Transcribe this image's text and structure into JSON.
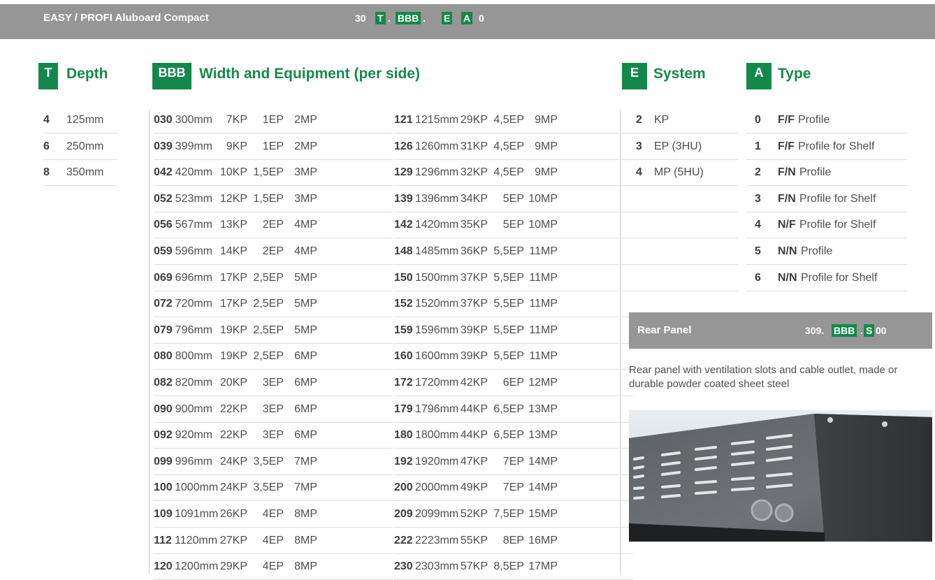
{
  "header": {
    "title": "EASY / PROFI Aluboard Compact",
    "code": {
      "prefix": "30",
      "t": "T",
      "sep1": ".",
      "bbb": "BBB",
      "sep2": ".",
      "e": "E",
      "a": "A",
      "suffix": "0"
    }
  },
  "sections": {
    "depth": {
      "badge": "T",
      "title": "Depth"
    },
    "width": {
      "badge": "BBB",
      "title": "Width and Equipment (per side)"
    },
    "system": {
      "badge": "E",
      "title": "System"
    },
    "type": {
      "badge": "A",
      "title": "Type"
    }
  },
  "depth_rows": [
    {
      "code": "4",
      "value": "125mm"
    },
    {
      "code": "6",
      "value": "250mm"
    },
    {
      "code": "8",
      "value": "350mm"
    }
  ],
  "width_left": [
    {
      "code": "030",
      "mm": "300mm",
      "kp": "7KP",
      "ep": "1EP",
      "mp": "2MP"
    },
    {
      "code": "039",
      "mm": "399mm",
      "kp": "9KP",
      "ep": "1EP",
      "mp": "2MP"
    },
    {
      "code": "042",
      "mm": "420mm",
      "kp": "10KP",
      "ep": "1,5EP",
      "mp": "3MP"
    },
    {
      "code": "052",
      "mm": "523mm",
      "kp": "12KP",
      "ep": "1,5EP",
      "mp": "3MP"
    },
    {
      "code": "056",
      "mm": "567mm",
      "kp": "13KP",
      "ep": "2EP",
      "mp": "4MP"
    },
    {
      "code": "059",
      "mm": "596mm",
      "kp": "14KP",
      "ep": "2EP",
      "mp": "4MP"
    },
    {
      "code": "069",
      "mm": "696mm",
      "kp": "17KP",
      "ep": "2,5EP",
      "mp": "5MP"
    },
    {
      "code": "072",
      "mm": "720mm",
      "kp": "17KP",
      "ep": "2,5EP",
      "mp": "5MP"
    },
    {
      "code": "079",
      "mm": "796mm",
      "kp": "19KP",
      "ep": "2,5EP",
      "mp": "5MP"
    },
    {
      "code": "080",
      "mm": "800mm",
      "kp": "19KP",
      "ep": "2,5EP",
      "mp": "6MP"
    },
    {
      "code": "082",
      "mm": "820mm",
      "kp": "20KP",
      "ep": "3EP",
      "mp": "6MP"
    },
    {
      "code": "090",
      "mm": "900mm",
      "kp": "22KP",
      "ep": "3EP",
      "mp": "6MP"
    },
    {
      "code": "092",
      "mm": "920mm",
      "kp": "22KP",
      "ep": "3EP",
      "mp": "6MP"
    },
    {
      "code": "099",
      "mm": "996mm",
      "kp": "24KP",
      "ep": "3,5EP",
      "mp": "7MP"
    },
    {
      "code": "100",
      "mm": "1000mm",
      "kp": "24KP",
      "ep": "3,5EP",
      "mp": "7MP"
    },
    {
      "code": "109",
      "mm": "1091mm",
      "kp": "26KP",
      "ep": "4EP",
      "mp": "8MP"
    },
    {
      "code": "112",
      "mm": "1120mm",
      "kp": "27KP",
      "ep": "4EP",
      "mp": "8MP"
    },
    {
      "code": "120",
      "mm": "1200mm",
      "kp": "29KP",
      "ep": "4EP",
      "mp": "8MP"
    }
  ],
  "width_right": [
    {
      "code": "121",
      "mm": "1215mm",
      "kp": "29KP",
      "ep": "4,5EP",
      "mp": "9MP"
    },
    {
      "code": "126",
      "mm": "1260mm",
      "kp": "31KP",
      "ep": "4,5EP",
      "mp": "9MP"
    },
    {
      "code": "129",
      "mm": "1296mm",
      "kp": "32KP",
      "ep": "4,5EP",
      "mp": "9MP"
    },
    {
      "code": "139",
      "mm": "1396mm",
      "kp": "34KP",
      "ep": "5EP",
      "mp": "10MP"
    },
    {
      "code": "142",
      "mm": "1420mm",
      "kp": "35KP",
      "ep": "5EP",
      "mp": "10MP"
    },
    {
      "code": "148",
      "mm": "1485mm",
      "kp": "36KP",
      "ep": "5,5EP",
      "mp": "11MP"
    },
    {
      "code": "150",
      "mm": "1500mm",
      "kp": "37KP",
      "ep": "5,5EP",
      "mp": "11MP"
    },
    {
      "code": "152",
      "mm": "1520mm",
      "kp": "37KP",
      "ep": "5,5EP",
      "mp": "11MP"
    },
    {
      "code": "159",
      "mm": "1596mm",
      "kp": "39KP",
      "ep": "5,5EP",
      "mp": "11MP"
    },
    {
      "code": "160",
      "mm": "1600mm",
      "kp": "39KP",
      "ep": "5,5EP",
      "mp": "11MP"
    },
    {
      "code": "172",
      "mm": "1720mm",
      "kp": "42KP",
      "ep": "6EP",
      "mp": "12MP"
    },
    {
      "code": "179",
      "mm": "1796mm",
      "kp": "44KP",
      "ep": "6,5EP",
      "mp": "13MP"
    },
    {
      "code": "180",
      "mm": "1800mm",
      "kp": "44KP",
      "ep": "6,5EP",
      "mp": "13MP"
    },
    {
      "code": "192",
      "mm": "1920mm",
      "kp": "47KP",
      "ep": "7EP",
      "mp": "14MP"
    },
    {
      "code": "200",
      "mm": "2000mm",
      "kp": "49KP",
      "ep": "7EP",
      "mp": "14MP"
    },
    {
      "code": "209",
      "mm": "2099mm",
      "kp": "52KP",
      "ep": "7,5EP",
      "mp": "15MP"
    },
    {
      "code": "222",
      "mm": "2223mm",
      "kp": "55KP",
      "ep": "8EP",
      "mp": "16MP"
    },
    {
      "code": "230",
      "mm": "2303mm",
      "kp": "57KP",
      "ep": "8,5EP",
      "mp": "17MP"
    }
  ],
  "system_rows": [
    {
      "code": "2",
      "label": "KP"
    },
    {
      "code": "3",
      "label": "EP (3HU)"
    },
    {
      "code": "4",
      "label": "MP (5HU)"
    }
  ],
  "type_rows": [
    {
      "code": "0",
      "bold": "F/F",
      "text": "Profile"
    },
    {
      "code": "1",
      "bold": "F/F",
      "text": "Profile for Shelf"
    },
    {
      "code": "2",
      "bold": "F/N",
      "text": "Profile"
    },
    {
      "code": "3",
      "bold": "F/N",
      "text": "Profile for Shelf"
    },
    {
      "code": "4",
      "bold": "N/F",
      "text": "Profile for Shelf"
    },
    {
      "code": "5",
      "bold": "N/N",
      "text": "Profile"
    },
    {
      "code": "6",
      "bold": "N/N",
      "text": "Profile for Shelf"
    }
  ],
  "rear_panel": {
    "label": "Rear Panel",
    "code_prefix": "309.",
    "code_bbb": "BBB",
    "code_sep": ".",
    "code_s": "S",
    "code_suffix": "00",
    "description": "Rear panel with ventilation slots and cable outlet, made or durable powder coated sheet steel"
  },
  "colors": {
    "accent": "#14884a",
    "bar": "#969696",
    "text": "#4d4d4d"
  }
}
